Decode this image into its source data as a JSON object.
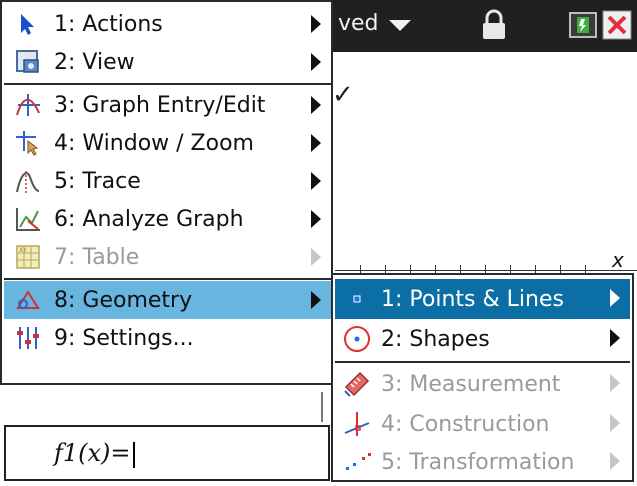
{
  "status_bar": {
    "doc_status": "ved"
  },
  "canvas": {
    "checkmark": "✓",
    "axis_label": "x"
  },
  "menu": {
    "items": [
      {
        "number_label": "1: Actions",
        "icon": "cursor-arrow-icon",
        "disabled": false,
        "selected": false
      },
      {
        "number_label": "2: View",
        "icon": "view-icon",
        "disabled": false,
        "selected": false
      },
      {
        "number_label": "3: Graph Entry/Edit",
        "icon": "graph-entry-icon",
        "disabled": false,
        "selected": false
      },
      {
        "number_label": "4: Window / Zoom",
        "icon": "window-zoom-icon",
        "disabled": false,
        "selected": false
      },
      {
        "number_label": "5: Trace",
        "icon": "trace-icon",
        "disabled": false,
        "selected": false
      },
      {
        "number_label": "6: Analyze Graph",
        "icon": "analyze-graph-icon",
        "disabled": false,
        "selected": false
      },
      {
        "number_label": "7: Table",
        "icon": "table-icon",
        "disabled": true,
        "selected": false
      },
      {
        "number_label": "8: Geometry",
        "icon": "geometry-icon",
        "disabled": false,
        "selected": true
      },
      {
        "number_label": "9: Settings...",
        "icon": "settings-icon",
        "disabled": false,
        "selected": false
      }
    ]
  },
  "submenu": {
    "items": [
      {
        "number_label": "1: Points & Lines",
        "icon": "points-lines-icon",
        "disabled": false,
        "selected": true
      },
      {
        "number_label": "2: Shapes",
        "icon": "shapes-icon",
        "disabled": false,
        "selected": false
      },
      {
        "number_label": "3: Measurement",
        "icon": "measurement-icon",
        "disabled": true,
        "selected": false
      },
      {
        "number_label": "4: Construction",
        "icon": "construction-icon",
        "disabled": true,
        "selected": false
      },
      {
        "number_label": "5: Transformation",
        "icon": "transformation-icon",
        "disabled": true,
        "selected": false
      }
    ]
  },
  "entry_line": {
    "text": "f1(x)="
  },
  "colors": {
    "menu_selected": "#68b5e0",
    "submenu_selected": "#0b6fa6",
    "topbar": "#202020"
  }
}
